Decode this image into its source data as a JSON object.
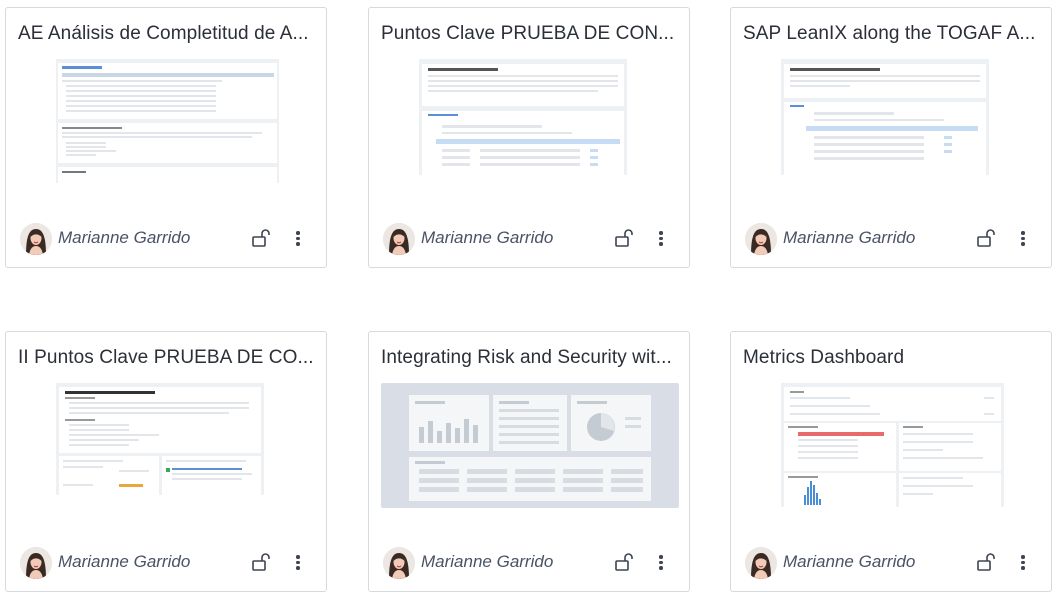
{
  "cards": [
    {
      "title": "AE Análisis de Completitud de A...",
      "owner": "Marianne Garrido"
    },
    {
      "title": "Puntos Clave PRUEBA DE CON...",
      "owner": "Marianne Garrido"
    },
    {
      "title": "SAP LeanIX along the TOGAF A...",
      "owner": "Marianne Garrido"
    },
    {
      "title": "II Puntos Clave PRUEBA DE CO...",
      "owner": "Marianne Garrido"
    },
    {
      "title": "Integrating Risk and Security wit...",
      "owner": "Marianne Garrido"
    },
    {
      "title": "Metrics Dashboard",
      "owner": "Marianne Garrido"
    }
  ],
  "icons": {
    "avatar": "avatar-photo",
    "lock": "unlock-icon",
    "menu": "more-vertical-icon"
  }
}
